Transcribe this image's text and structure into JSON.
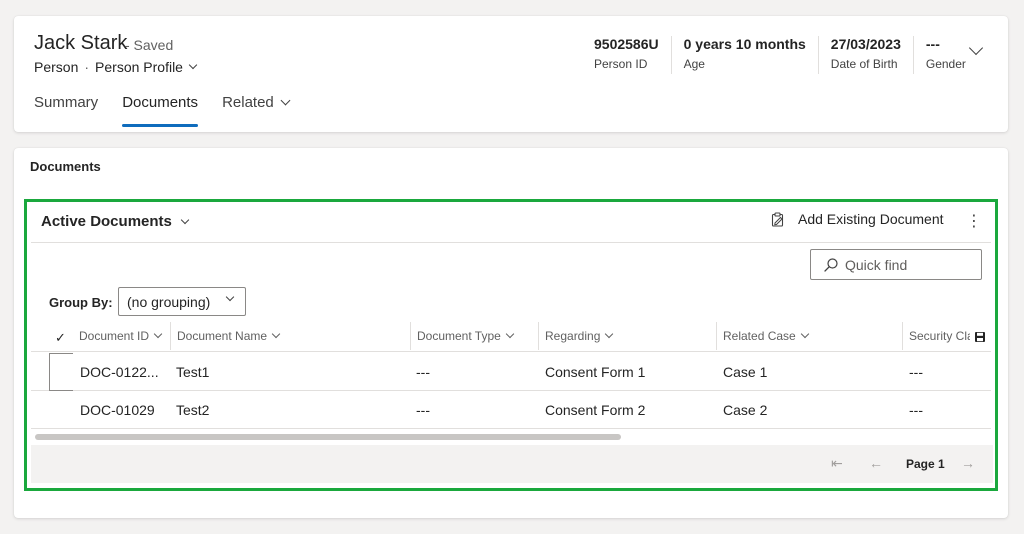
{
  "record": {
    "name": "Jack Stark",
    "saved_status": "- Saved",
    "entity": "Person",
    "separator": "·",
    "form": "Person Profile"
  },
  "header_fields": [
    {
      "value": "9502586U",
      "label": "Person ID"
    },
    {
      "value": "0 years 10 months",
      "label": "Age"
    },
    {
      "value": "27/03/2023",
      "label": "Date of Birth"
    },
    {
      "value": "---",
      "label": "Gender"
    }
  ],
  "tabs": [
    {
      "label": "Summary",
      "active": false
    },
    {
      "label": "Documents",
      "active": true
    },
    {
      "label": "Related",
      "active": false
    }
  ],
  "section": {
    "title": "Documents"
  },
  "subgrid": {
    "view_name": "Active Documents",
    "add_existing_label": "Add Existing Document",
    "more_commands": "⋮",
    "quick_find_placeholder": "Quick find",
    "group_by_label": "Group By:",
    "group_by_value": "(no grouping)",
    "check_all": "✓",
    "columns": [
      {
        "label": "Document ID"
      },
      {
        "label": "Document Name"
      },
      {
        "label": "Document Type"
      },
      {
        "label": "Regarding"
      },
      {
        "label": "Related Case"
      },
      {
        "label": "Security Cla"
      }
    ],
    "rows": [
      {
        "doc_id": "DOC-0122...",
        "doc_name": "Test1",
        "doc_type": "---",
        "regarding": "Consent Form 1",
        "related_case": "Case 1",
        "security": "---"
      },
      {
        "doc_id": "DOC-01029",
        "doc_name": "Test2",
        "doc_type": "---",
        "regarding": "Consent Form 2",
        "related_case": "Case 2",
        "security": "---"
      }
    ],
    "pager": {
      "first": "⇤",
      "prev": "←",
      "page_label": "Page 1",
      "next": "→"
    }
  },
  "colors": {
    "accent": "#0f6cbd",
    "highlight_border": "#1aa83d"
  }
}
